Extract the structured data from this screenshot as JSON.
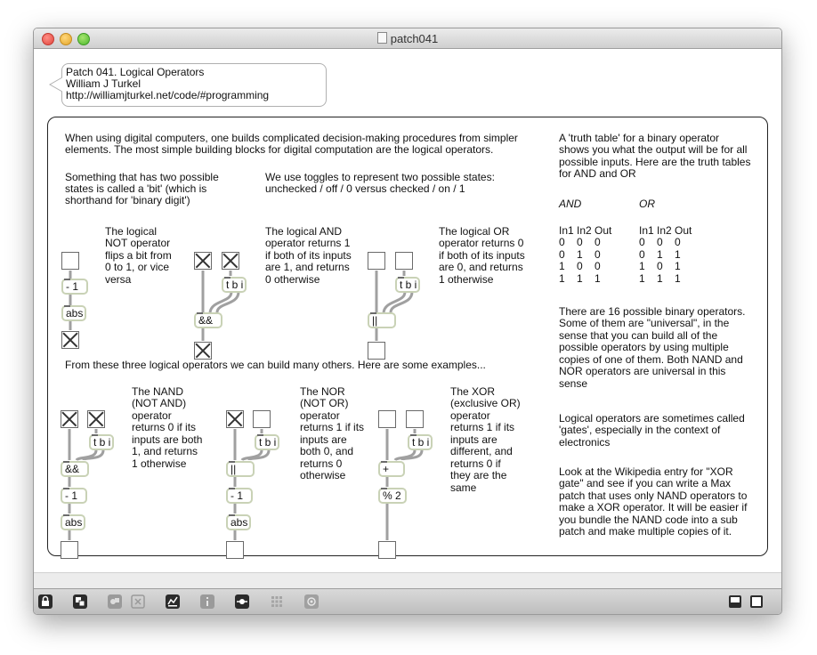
{
  "window": {
    "title": "patch041"
  },
  "header_comment": [
    "Patch 041. Logical Operators",
    "William J Turkel",
    "http://williamjturkel.net/code/#programming"
  ],
  "intro": [
    "When using digital computers, one builds complicated decision-making procedures from simpler",
    "elements. The most simple building blocks for digital computation are the logical operators."
  ],
  "bit_text": [
    "Something that has two possible",
    "states is called a 'bit' (which is",
    "shorthand for 'binary digit')"
  ],
  "toggle_text": [
    "We use toggles to represent two possible states:",
    "unchecked / off / 0 versus checked / on / 1"
  ],
  "not_text": [
    "The logical",
    "NOT operator",
    "flips a bit from",
    "0 to 1, or vice",
    "versa"
  ],
  "and_text": [
    "The logical AND",
    "operator returns 1",
    "if both of its inputs",
    "are 1, and returns",
    "0 otherwise"
  ],
  "or_text": [
    "The logical OR",
    "operator returns 0",
    "if both of its inputs",
    "are 0, and returns",
    "1 otherwise"
  ],
  "examples_text": "From these three logical operators we can build many others. Here are some examples...",
  "nand_text": [
    "The NAND",
    "(NOT AND)",
    "operator",
    "returns 0 if its",
    "inputs are both",
    "1, and returns",
    "1 otherwise"
  ],
  "nor_text": [
    "The NOR",
    "(NOT OR)",
    "operator",
    "returns 1 if its",
    "inputs are",
    "both 0, and",
    "returns 0",
    "otherwise"
  ],
  "xor_text": [
    "The XOR",
    "(exclusive OR)",
    "operator",
    "returns 1 if its",
    "inputs are",
    "different, and",
    "returns 0 if",
    "they are the",
    "same"
  ],
  "truth_intro": [
    "A 'truth table' for a binary operator",
    "shows you what the output will be for all",
    "possible inputs. Here are the truth tables",
    "for AND and OR"
  ],
  "and_table": {
    "title": "AND",
    "header": "In1 In2 Out",
    "rows": [
      "0    0    0",
      "0    1    0",
      "1    0    0",
      "1    1    1"
    ]
  },
  "or_table": {
    "title": "OR",
    "header": "In1 In2 Out",
    "rows": [
      "0    0    0",
      "0    1    1",
      "1    0    1",
      "1    1    1"
    ]
  },
  "universal_text": [
    "There are 16 possible binary operators.",
    "Some of them are \"universal\", in the",
    "sense that you can build all of the",
    "possible operators by using multiple",
    "copies of one of them. Both NAND and",
    "NOR operators are universal in this",
    "sense"
  ],
  "gates_text": [
    "Logical operators are sometimes called",
    "'gates', especially in the context of",
    "electronics"
  ],
  "xor_exercise": [
    "Look at the Wikipedia entry for \"XOR",
    "gate\" and see if you can write a Max",
    "patch that uses only NAND operators to",
    "make a XOR operator. It will be easier if",
    "you bundle the NAND code into a sub",
    "patch and make multiple copies of it."
  ],
  "objects": {
    "minus1": "- 1",
    "abs": "abs",
    "tbi": "t b i",
    "and": "&&",
    "or": "||",
    "plus": "+",
    "mod2": "% 2"
  },
  "toolbar_icons": [
    "lock-icon",
    "presentation-icon",
    "object-palette-icon",
    "delete-icon",
    "inspector-icon",
    "info-icon",
    "patch-cord-icon",
    "grid-icon",
    "snapshot-icon",
    "split-view-icon",
    "single-view-icon"
  ]
}
